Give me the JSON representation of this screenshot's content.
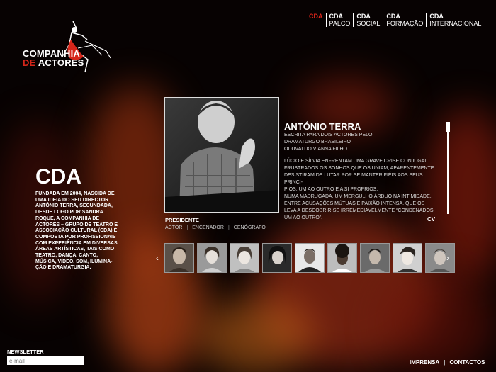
{
  "brand": {
    "line1": "COMPANHIA",
    "line2_red": "DE",
    "line2_white": "ACTORES"
  },
  "nav": [
    {
      "bold": "CDA",
      "sub": ""
    },
    {
      "bold": "CDA",
      "sub": "PALCO"
    },
    {
      "bold": "CDA",
      "sub": "SOCIAL"
    },
    {
      "bold": "CDA",
      "sub": "FORMAÇÃO"
    },
    {
      "bold": "CDA",
      "sub": "INTERNACIONAL"
    }
  ],
  "feature": {
    "name": "ANTÓNIO TERRA",
    "subtitle_lines": [
      "ESCRITA PARA DOIS ACTORES PELO",
      "DRAMATURGO BRASILEIRO",
      "ODUVALDO VIANNA FILHO."
    ],
    "desc_lines": [
      "LÚCIO E SÍLVIA ENFRENTAM UMA GRAVE CRISE CONJUGAL.",
      "FRUSTRADOS OS SONHOS QUE OS UNIAM, APARENTEMENTE",
      "DESISTIRAM DE LUTAR POR SE MANTER FIÉIS AOS SEUS PRINCÍ-",
      "PIOS, UM AO OUTRO E A SI PRÓPRIOS.",
      "NUMA MADRUGADA, UM MERGULHO ÁRDUO NA INTIMIDADE,",
      "ENTRE ACUSAÇÕES MÚTUAS E PAIXÃO INTENSA, QUE OS",
      "LEVA A DESCOBRIR-SE IRREMEDIAVELMENTE “CONDENADOS",
      "UM AO OUTRO”."
    ],
    "cv_label": "CV",
    "role_title": "PRESIDENTE",
    "roles": [
      "ACTOR",
      "ENCENADOR",
      "CENÓGRAFO"
    ],
    "role_separator": "|"
  },
  "about": {
    "heading": "CDA",
    "lines": [
      "FUNDADA EM 2004, NASCIDA DE",
      "UMA IDEIA DO SEU DIRECTOR",
      "ANTÓNIO TERRA, SECUNDADA,",
      "DESDE LOGO POR SANDRA",
      "ROQUE, A COMPANHIA DE",
      "ACTORES – GRUPO DE TEATRO E",
      "ASSOCIAÇÃO CULTURAL (CDA) É",
      "COMPOSTA POR PROFISSIONAIS",
      "COM EXPERIÊNCIA EM DIVERSAS",
      "ÁREAS ARTÍSTICAS, TAIS COMO",
      "TEATRO, DANÇA, CANTO,",
      "MÚSICA, VÍDEO, SOM, ILUMINA-",
      "ÇÃO E DRAMATURGIA."
    ]
  },
  "carousel": {
    "prev": "‹",
    "next": "›",
    "thumbs": [
      "m1",
      "f1",
      "f2",
      "f3",
      "m2",
      "f4",
      "m3",
      "f5",
      "m4"
    ]
  },
  "newsletter": {
    "label": "NEWSLETTER",
    "placeholder": "e-mail",
    "go": "›"
  },
  "footer": {
    "press": "IMPRENSA",
    "sep": "|",
    "contacts": "CONTACTOS"
  },
  "colors": {
    "accent": "#e2261b",
    "bg": "#070202"
  }
}
